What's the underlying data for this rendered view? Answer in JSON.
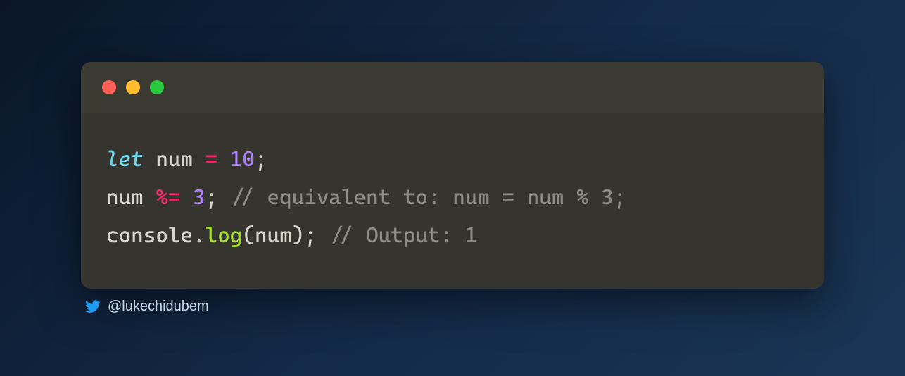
{
  "window": {
    "traffic_lights": [
      "red",
      "yellow",
      "green"
    ]
  },
  "code": {
    "line1": {
      "kw": "let",
      "sp1": " ",
      "ident": "num",
      "sp2": " ",
      "op": "=",
      "sp3": " ",
      "num": "10",
      "punct": ";"
    },
    "line2": {
      "ident": "num",
      "sp1": " ",
      "op": "%=",
      "sp2": " ",
      "num": "3",
      "punct": ";",
      "sp3": " ",
      "comment": "// equivalent to: num = num % 3;"
    },
    "line3": {
      "obj": "console",
      "dot": ".",
      "fn": "log",
      "open": "(",
      "arg": "num",
      "close": ")",
      "punct": ";",
      "sp": " ",
      "comment": "// Output: 1"
    }
  },
  "attribution": {
    "handle": "@lukechidubem"
  }
}
